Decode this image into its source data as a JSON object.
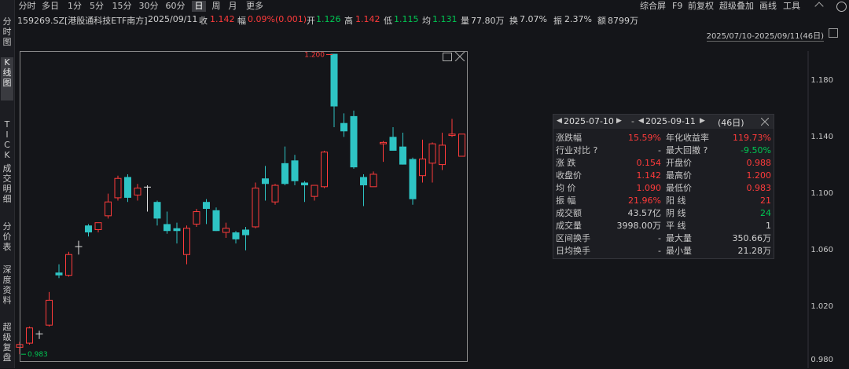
{
  "left_tabs": [
    "分时图",
    "K线图",
    "TICK",
    "成交明细",
    "分价表",
    "深度资料",
    "超级复盘"
  ],
  "periods": [
    "分时",
    "多日",
    "1分",
    "5分",
    "15分",
    "30分",
    "60分",
    "日",
    "周",
    "月",
    "更多"
  ],
  "menu": [
    "综合屏",
    "F9",
    "前复权",
    "超级叠加",
    "画线",
    "工具"
  ],
  "quote": {
    "code_name": "159269.SZ[港股通科技ETF南方]",
    "date": "2025/09/11",
    "close_label": "收",
    "close": "1.142",
    "change_label": "幅",
    "change": "0.09%(0.001)",
    "open_label": "开",
    "open": "1.126",
    "high_label": "高",
    "high": "1.142",
    "low_label": "低",
    "low": "1.115",
    "avg_label": "均",
    "avg": "1.131",
    "vol_label": "量",
    "vol": "77.80万",
    "turnover_label": "换",
    "turnover": "7.07%",
    "amp_label": "振",
    "amp": "2.37%",
    "amount_label": "额",
    "amount": "8799万"
  },
  "range_label": "2025/07/10-2025/09/11(46日)",
  "panel": {
    "start": "2025-07-10",
    "end": "2025-09-11",
    "days": "(46日)",
    "rows": [
      [
        "涨跌幅",
        "15.59%",
        "年化收益率",
        "119.73%"
      ],
      [
        "行业对比 ?",
        "-",
        "最大回撤 ?",
        "-9.50%"
      ],
      [
        "涨    跌",
        "0.154",
        "开盘价",
        "0.988"
      ],
      [
        "收盘价",
        "1.142",
        "最高价",
        "1.200"
      ],
      [
        "均    价",
        "1.090",
        "最低价",
        "0.983"
      ],
      [
        "振    幅",
        "21.96%",
        "阳    线",
        "21"
      ],
      [
        "成交额",
        "43.57亿",
        "阴    线",
        "24"
      ],
      [
        "成交量",
        "3998.00万",
        "平    线",
        "1"
      ],
      [
        "区间换手",
        "-",
        "最大量",
        "350.66万"
      ],
      [
        "日均换手",
        "-",
        "最小量",
        "21.28万"
      ]
    ],
    "row_colors": [
      [
        "#ff3b3b",
        "#ff3b3b"
      ],
      [
        "#d0d0d0",
        "#00c853"
      ],
      [
        "#ff3b3b",
        "#ff3b3b"
      ],
      [
        "#ff3b3b",
        "#ff3b3b"
      ],
      [
        "#ff3b3b",
        "#ff3b3b"
      ],
      [
        "#ff3b3b",
        "#ff3b3b"
      ],
      [
        "#d0d0d0",
        "#00c853"
      ],
      [
        "#d0d0d0",
        "#d0d0d0"
      ],
      [
        "#d0d0d0",
        "#d0d0d0"
      ],
      [
        "#d0d0d0",
        "#d0d0d0"
      ]
    ]
  },
  "chart_data": {
    "type": "candlestick",
    "y_ticks": [
      "1.180",
      "1.140",
      "1.100",
      "1.060",
      "1.020",
      "0.980"
    ],
    "ylim": [
      0.978,
      1.202
    ],
    "max_label": "1.200",
    "min_label": "0.983",
    "colors": {
      "up": "#ff3b3b",
      "down": "#2ec4c4",
      "flat": "#e0e0e0"
    },
    "candles": [
      {
        "o": 0.988,
        "h": 0.992,
        "l": 0.983,
        "c": 0.99
      },
      {
        "o": 0.991,
        "h": 1.003,
        "l": 0.99,
        "c": 1.002
      },
      {
        "o": 0.998,
        "h": 1.0,
        "l": 0.994,
        "c": 0.998
      },
      {
        "o": 1.004,
        "h": 1.028,
        "l": 1.003,
        "c": 1.022
      },
      {
        "o": 1.042,
        "h": 1.048,
        "l": 1.038,
        "c": 1.04
      },
      {
        "o": 1.04,
        "h": 1.057,
        "l": 1.039,
        "c": 1.055
      },
      {
        "o": 1.061,
        "h": 1.065,
        "l": 1.055,
        "c": 1.061
      },
      {
        "o": 1.076,
        "h": 1.077,
        "l": 1.068,
        "c": 1.071
      },
      {
        "o": 1.073,
        "h": 1.078,
        "l": 1.071,
        "c": 1.078
      },
      {
        "o": 1.083,
        "h": 1.099,
        "l": 1.081,
        "c": 1.093
      },
      {
        "o": 1.096,
        "h": 1.112,
        "l": 1.094,
        "c": 1.11
      },
      {
        "o": 1.111,
        "h": 1.113,
        "l": 1.093,
        "c": 1.096
      },
      {
        "o": 1.098,
        "h": 1.106,
        "l": 1.094,
        "c": 1.103
      },
      {
        "o": 1.104,
        "h": 1.105,
        "l": 1.086,
        "c": 1.104
      },
      {
        "o": 1.093,
        "h": 1.094,
        "l": 1.076,
        "c": 1.081
      },
      {
        "o": 1.077,
        "h": 1.086,
        "l": 1.07,
        "c": 1.072
      },
      {
        "o": 1.074,
        "h": 1.078,
        "l": 1.063,
        "c": 1.072
      },
      {
        "o": 1.055,
        "h": 1.076,
        "l": 1.048,
        "c": 1.074
      },
      {
        "o": 1.077,
        "h": 1.088,
        "l": 1.075,
        "c": 1.086
      },
      {
        "o": 1.093,
        "h": 1.095,
        "l": 1.077,
        "c": 1.088
      },
      {
        "o": 1.087,
        "h": 1.089,
        "l": 1.072,
        "c": 1.072
      },
      {
        "o": 1.071,
        "h": 1.078,
        "l": 1.067,
        "c": 1.074
      },
      {
        "o": 1.071,
        "h": 1.072,
        "l": 1.063,
        "c": 1.066
      },
      {
        "o": 1.073,
        "h": 1.075,
        "l": 1.058,
        "c": 1.069
      },
      {
        "o": 1.075,
        "h": 1.107,
        "l": 1.074,
        "c": 1.103
      },
      {
        "o": 1.11,
        "h": 1.119,
        "l": 1.094,
        "c": 1.106
      },
      {
        "o": 1.093,
        "h": 1.106,
        "l": 1.091,
        "c": 1.105
      },
      {
        "o": 1.121,
        "h": 1.133,
        "l": 1.105,
        "c": 1.106
      },
      {
        "o": 1.123,
        "h": 1.127,
        "l": 1.105,
        "c": 1.108
      },
      {
        "o": 1.107,
        "h": 1.108,
        "l": 1.093,
        "c": 1.105
      },
      {
        "o": 1.097,
        "h": 1.104,
        "l": 1.094,
        "c": 1.105
      },
      {
        "o": 1.104,
        "h": 1.13,
        "l": 1.103,
        "c": 1.129
      },
      {
        "o": 1.2,
        "h": 1.2,
        "l": 1.147,
        "c": 1.162
      },
      {
        "o": 1.15,
        "h": 1.157,
        "l": 1.14,
        "c": 1.144
      },
      {
        "o": 1.155,
        "h": 1.159,
        "l": 1.117,
        "c": 1.118
      },
      {
        "o": 1.111,
        "h": 1.113,
        "l": 1.09,
        "c": 1.105
      },
      {
        "o": 1.104,
        "h": 1.115,
        "l": 1.104,
        "c": 1.113
      },
      {
        "o": 1.135,
        "h": 1.137,
        "l": 1.122,
        "c": 1.136
      },
      {
        "o": 1.14,
        "h": 1.147,
        "l": 1.13,
        "c": 1.13
      },
      {
        "o": 1.133,
        "h": 1.143,
        "l": 1.12,
        "c": 1.12
      },
      {
        "o": 1.124,
        "h": 1.125,
        "l": 1.091,
        "c": 1.095
      },
      {
        "o": 1.112,
        "h": 1.138,
        "l": 1.107,
        "c": 1.124
      },
      {
        "o": 1.121,
        "h": 1.136,
        "l": 1.107,
        "c": 1.135
      },
      {
        "o": 1.12,
        "h": 1.143,
        "l": 1.116,
        "c": 1.134
      },
      {
        "o": 1.141,
        "h": 1.153,
        "l": 1.14,
        "c": 1.142
      },
      {
        "o": 1.126,
        "h": 1.142,
        "l": 1.126,
        "c": 1.142
      }
    ]
  }
}
